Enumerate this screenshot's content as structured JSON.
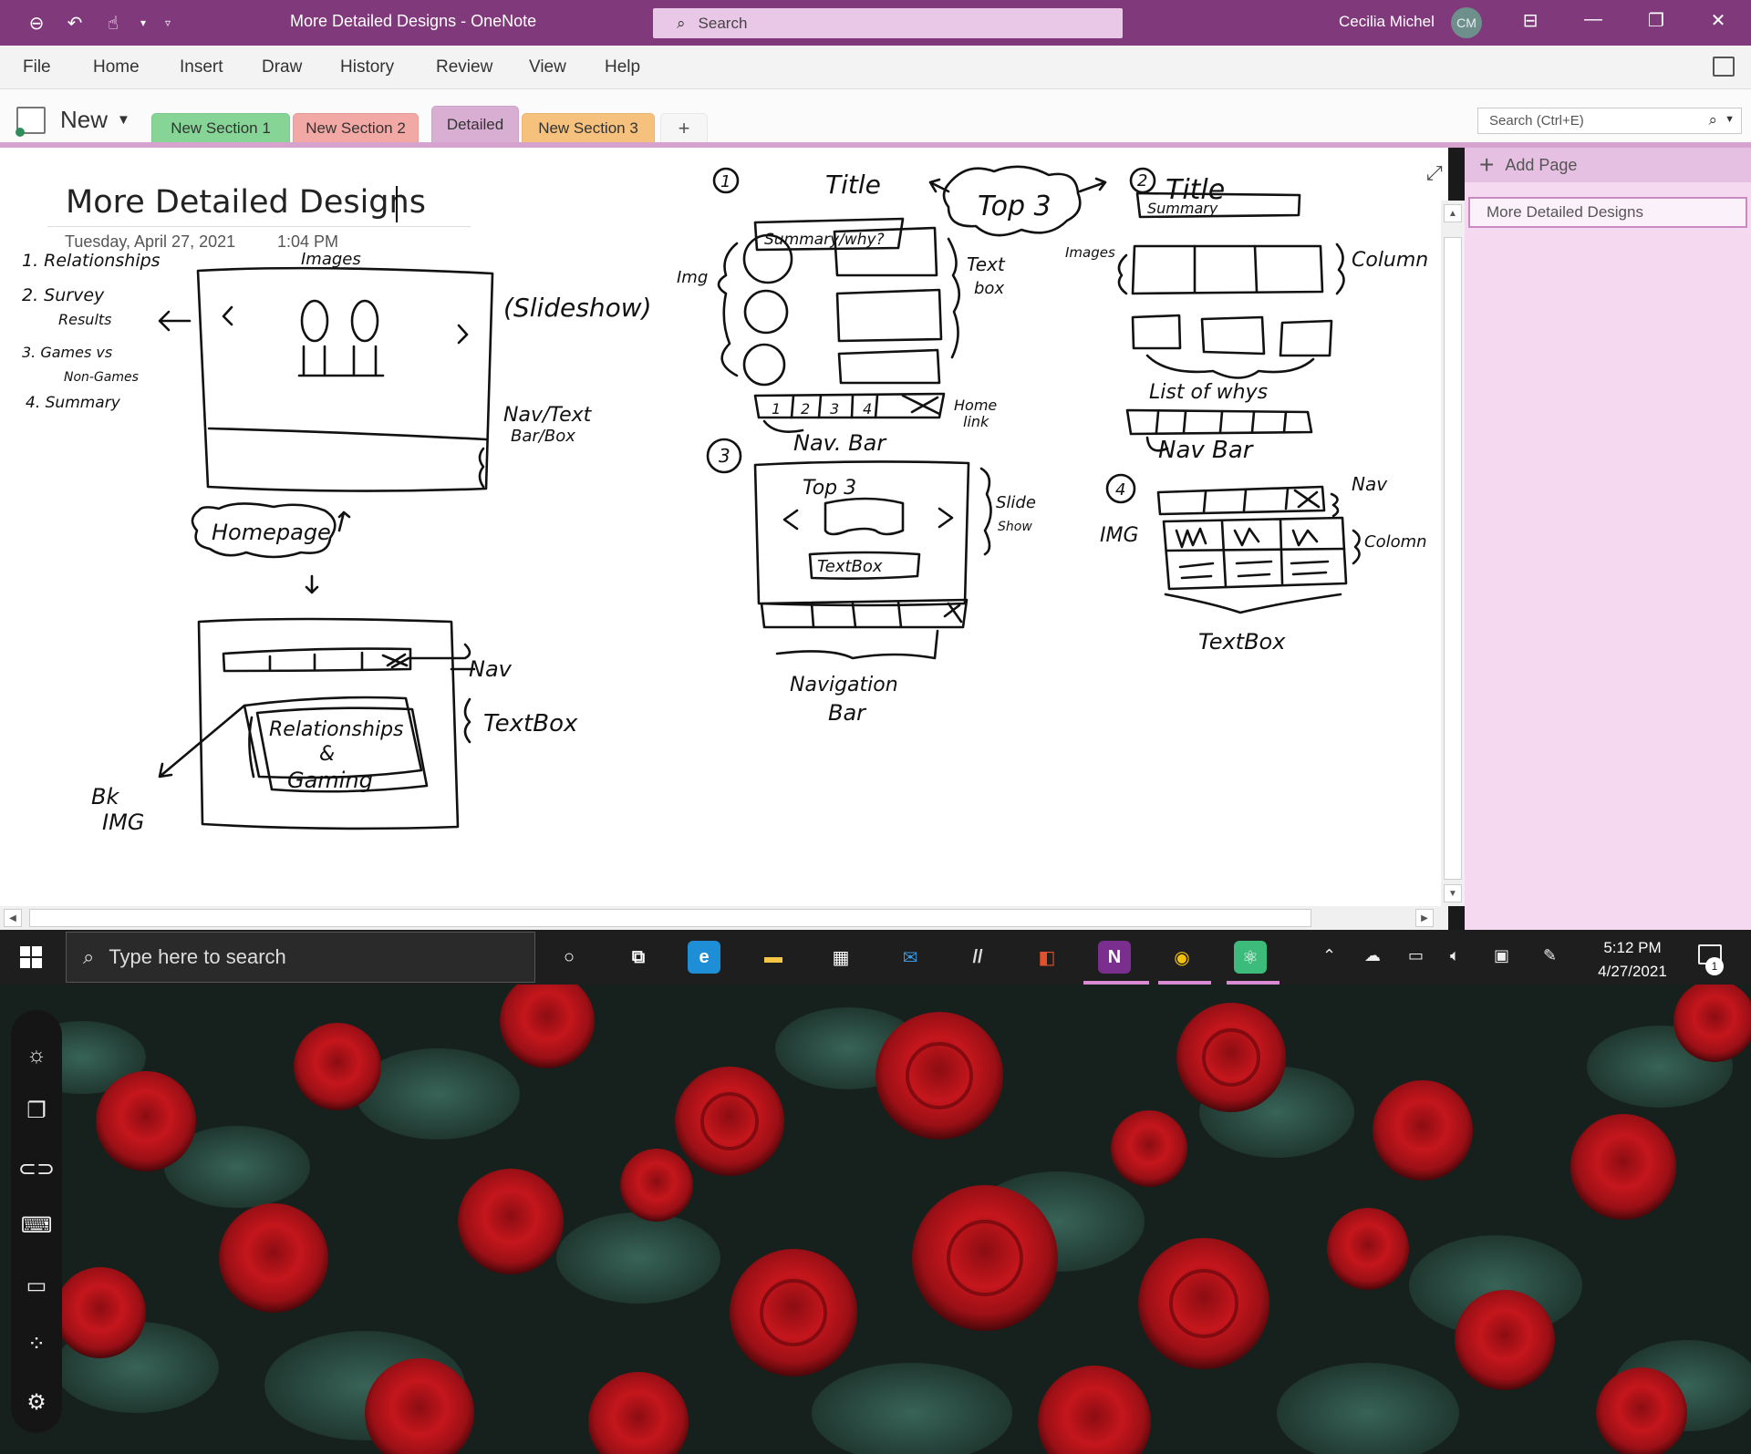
{
  "titlebar": {
    "doc_title": "More Detailed Designs  -  OneNote",
    "search_placeholder": "Search",
    "user_name": "Cecilia Michel",
    "user_initials": "CM"
  },
  "menu": [
    "File",
    "Home",
    "Insert",
    "Draw",
    "History",
    "Review",
    "View",
    "Help"
  ],
  "notebook": {
    "label": "New"
  },
  "tabs": [
    {
      "label": "New Section 1",
      "color": "#86d597"
    },
    {
      "label": "New Section 2",
      "color": "#f2a8a4"
    },
    {
      "label": "Detailed",
      "color": "#d9aed3"
    },
    {
      "label": "New Section 3",
      "color": "#f6c17d"
    }
  ],
  "add_tab_label": "+",
  "search_box": {
    "placeholder": "Search (Ctrl+E)"
  },
  "page": {
    "title": "More Detailed Designs",
    "date": "Tuesday, April 27, 2021",
    "time": "1:04 PM"
  },
  "pagelist": {
    "add_page_label": "Add Page",
    "pages": [
      "More Detailed Designs"
    ]
  },
  "sketch_text": {
    "list1": "1. Relationships",
    "list2": "2. Survey",
    "list2b": "Results",
    "list3": "3. Games vs",
    "list3b": "Non-Games",
    "list4": "4. Summary",
    "images": "Images",
    "slideshow": "(Slideshow)",
    "navtext": "Nav/Text",
    "barbox": "Bar/Box",
    "homepage": "Homepage",
    "nav1": "Nav",
    "textbox1": "TextBox",
    "relgaming1": "Relationships",
    "relgaming2": "&",
    "relgaming3": "Gaming",
    "bkimg1": "Bk",
    "bkimg2": "IMG",
    "n1": "1",
    "title1": "Title",
    "summary1": "Summary/why?",
    "top3": "Top 3",
    "img1": "Img",
    "textbox2a": "Text",
    "textbox2b": "box",
    "navbar_nums": [
      "1",
      "2",
      "3",
      "4"
    ],
    "home_link_a": "Home",
    "home_link_b": "link",
    "navbar1": "Nav. Bar",
    "n2": "2",
    "title2": "Title",
    "summary2": "Summary",
    "images2": "Images",
    "column1": "Column",
    "list_whys": "List of whys",
    "navbar2": "Nav Bar",
    "n3": "3",
    "top3b": "Top 3",
    "slideshow2a": "Slide",
    "slideshow2b": "Show",
    "textbox3": "TextBox",
    "navigation": "Navigation",
    "bar3": "Bar",
    "n4": "4",
    "nav4": "Nav",
    "img4": "IMG",
    "column4": "Colomn",
    "textbox4": "TextBox"
  },
  "taskbar": {
    "search_placeholder": "Type here to search",
    "time": "5:12 PM",
    "date": "4/27/2021",
    "notification_count": "1",
    "apps": [
      {
        "name": "cortana-icon",
        "glyph": "○",
        "color": "#ffffff",
        "bg": "transparent"
      },
      {
        "name": "task-view-icon",
        "glyph": "⧉",
        "color": "#ffffff",
        "bg": "transparent"
      },
      {
        "name": "edge-icon",
        "glyph": "e",
        "color": "#ffffff",
        "bg": "#1e8fd6"
      },
      {
        "name": "file-explorer-icon",
        "glyph": "▬",
        "color": "#f6c745",
        "bg": "transparent"
      },
      {
        "name": "store-icon",
        "glyph": "▦",
        "color": "#ffffff",
        "bg": "transparent"
      },
      {
        "name": "mail-icon",
        "glyph": "✉",
        "color": "#3a96dd",
        "bg": "transparent"
      },
      {
        "name": "ink-app-icon",
        "glyph": "//",
        "color": "#dddddd",
        "bg": "transparent"
      },
      {
        "name": "office-icon",
        "glyph": "◧",
        "color": "#e2512c",
        "bg": "transparent"
      },
      {
        "name": "onenote-icon",
        "glyph": "N",
        "color": "#ffffff",
        "bg": "#7a2f8e"
      },
      {
        "name": "chrome-icon",
        "glyph": "◉",
        "color": "#f4c20d",
        "bg": "transparent"
      },
      {
        "name": "atom-icon",
        "glyph": "⚛",
        "color": "#ffffff",
        "bg": "#3dbb7a"
      }
    ]
  },
  "colors": {
    "titlebar_bg": "#80397b",
    "tab_underline": "#d5a3cd",
    "pagelist_bg": "#f4d9f1",
    "taskbar_bg": "#1e1e1e",
    "active_indicator": "#d98ad2"
  }
}
